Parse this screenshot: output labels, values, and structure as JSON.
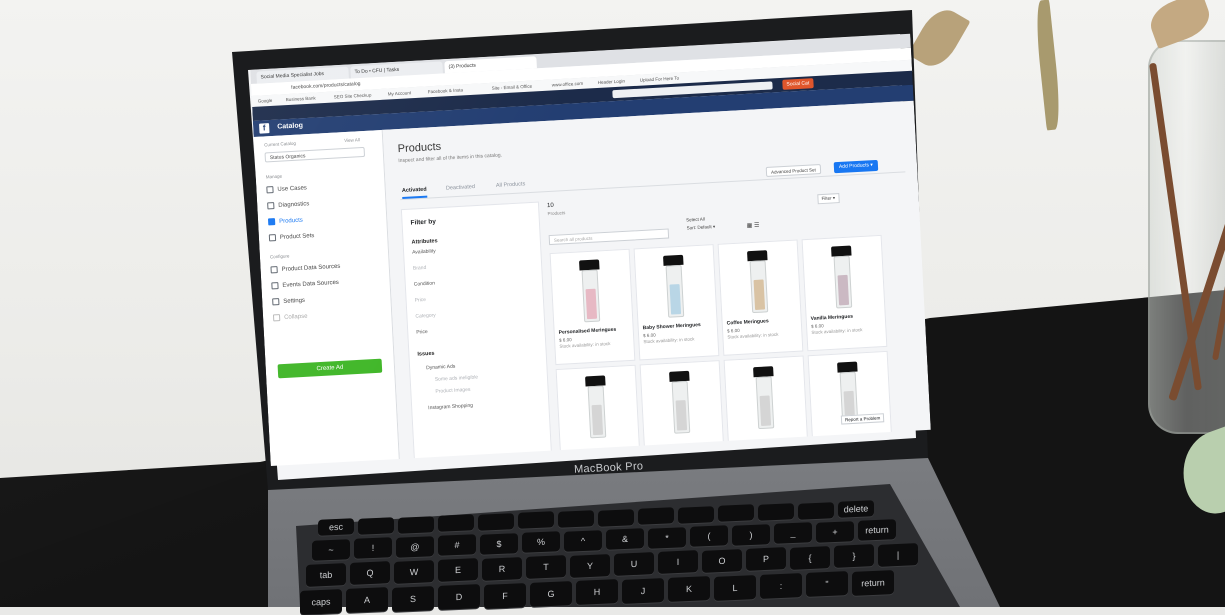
{
  "scene": {
    "laptop_brand": "MacBook Pro"
  },
  "browser": {
    "tabs": [
      {
        "label": "Social Media Specialist Jobs"
      },
      {
        "label": "To Do • CFU | Tasks"
      },
      {
        "label": "(3) Products"
      }
    ],
    "url": "facebook.com/products/catalog",
    "bookmarks": [
      "Google",
      "Business Bank",
      "SEO Site Checkup",
      "My Account",
      "Facebook & Insta",
      "Site - Email & Office",
      "www.office.com",
      "Header Login",
      "Upload For Here To"
    ]
  },
  "facebook_bar": {
    "user": "Social Cat"
  },
  "catalog_bar": {
    "title": "Catalog"
  },
  "sidebar": {
    "current_catalog_label": "Current Catalog",
    "view_all": "View All",
    "catalog_value": "Status Organics",
    "manage_label": "Manage",
    "items": [
      {
        "label": "Use Cases",
        "icon": "use-cases-icon"
      },
      {
        "label": "Diagnostics",
        "icon": "diagnostics-icon"
      },
      {
        "label": "Products",
        "icon": "products-icon",
        "active": true
      },
      {
        "label": "Product Sets",
        "icon": "product-sets-icon"
      }
    ],
    "configure_label": "Configure",
    "config_items": [
      {
        "label": "Product Data Sources",
        "icon": "data-sources-icon"
      },
      {
        "label": "Events Data Sources",
        "icon": "events-icon"
      },
      {
        "label": "Settings",
        "icon": "gear-icon"
      },
      {
        "label": "Collapse",
        "icon": "collapse-icon"
      }
    ],
    "create_ad": "Create Ad"
  },
  "main": {
    "title": "Products",
    "subtitle": "Inspect and filter all of the items in this catalog.",
    "tabs": [
      {
        "label": "Activated",
        "active": true
      },
      {
        "label": "Deactivated"
      },
      {
        "label": "All Products"
      }
    ],
    "advanced_button": "Advanced Product Set",
    "add_button": "Add Products ▾"
  },
  "filter": {
    "heading": "Filter by",
    "lines": [
      {
        "text": "Attributes",
        "style": "bold"
      },
      {
        "text": "Availability",
        "style": ""
      },
      {
        "text": "Brand",
        "style": "faint"
      },
      {
        "text": "Condition",
        "style": ""
      },
      {
        "text": "Price",
        "style": "faint"
      },
      {
        "text": "Category",
        "style": "faint"
      },
      {
        "text": "Price",
        "style": ""
      },
      {
        "text": "Issues",
        "style": "bold"
      },
      {
        "text": "Dynamic Ads",
        "style": ""
      },
      {
        "text": "Some ads ineligible",
        "style": "faint"
      },
      {
        "text": "Product Images",
        "style": "faint"
      },
      {
        "text": "Instagram Shopping",
        "style": ""
      }
    ]
  },
  "grid": {
    "count": "10",
    "count_label": "Products",
    "search_placeholder": "Search all products",
    "select_all": "Select All",
    "sort": "Sort: Default ▾",
    "filters_button": "Filter ▾",
    "report_button": "Report a Problem",
    "products": [
      {
        "name": "Personalised Meringues",
        "price": "$ 6.00",
        "stock": "Stock availability: in stock",
        "fill": "#e7b9c4"
      },
      {
        "name": "Baby Shower Meringues",
        "price": "$ 6.00",
        "stock": "Stock availability: in stock",
        "fill": "#b9d6e6"
      },
      {
        "name": "Coffee Meringues",
        "price": "$ 6.00",
        "stock": "Stock availability: in stock",
        "fill": "#d9c3a4"
      },
      {
        "name": "Vanilla Meringues",
        "price": "$ 6.00",
        "stock": "Stock availability: in stock",
        "fill": "#cbb9c3"
      },
      {
        "name": "",
        "price": "",
        "stock": "",
        "fill": "#d5d5d5"
      },
      {
        "name": "",
        "price": "",
        "stock": "",
        "fill": "#d5d5d5"
      },
      {
        "name": "",
        "price": "",
        "stock": "",
        "fill": "#d5d5d5"
      },
      {
        "name": "",
        "price": "",
        "stock": "",
        "fill": "#d5d5d5"
      }
    ]
  },
  "keyboard": {
    "rows": [
      [
        "esc",
        "",
        "",
        "",
        "",
        "",
        "",
        "",
        "",
        "",
        "",
        "",
        "",
        "delete"
      ],
      [
        "~",
        "!",
        "@",
        "#",
        "$",
        "%",
        "^",
        "&",
        "*",
        "(",
        ")",
        "_",
        "+",
        "return"
      ],
      [
        "tab",
        "Q",
        "W",
        "E",
        "R",
        "T",
        "Y",
        "U",
        "I",
        "O",
        "P",
        "{",
        "}",
        "|"
      ],
      [
        "caps",
        "A",
        "S",
        "D",
        "F",
        "G",
        "H",
        "J",
        "K",
        "L",
        ":",
        "\"",
        "return"
      ]
    ]
  }
}
